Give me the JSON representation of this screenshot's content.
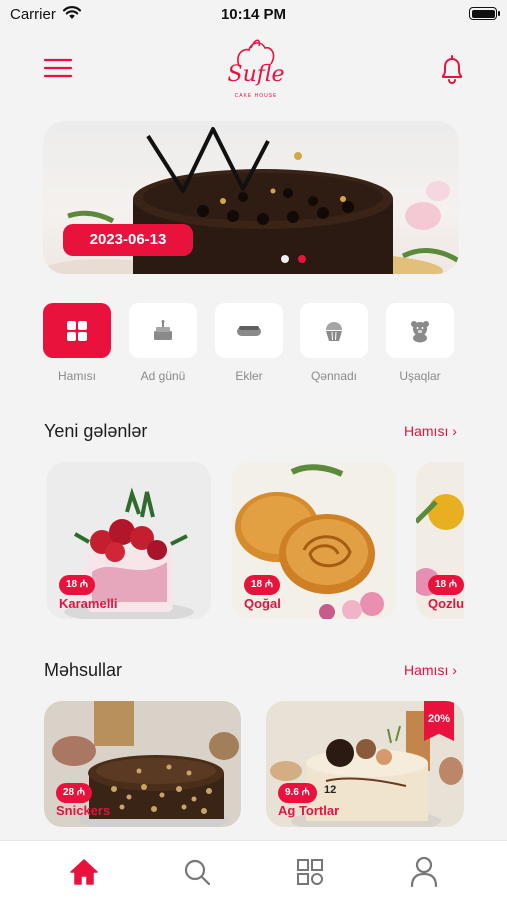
{
  "status_bar": {
    "carrier": "Carrier",
    "time": "10:14 PM"
  },
  "header": {
    "logo_text": "Sufle",
    "logo_subtext": "CAKE HOUSE"
  },
  "colors": {
    "accent": "#e8123c",
    "background": "#f3f3f3",
    "card": "#ffffff",
    "muted": "#8a8a8a"
  },
  "banner": {
    "date": "2023-06-13",
    "slide_count": 2,
    "active_slide": 2
  },
  "categories": [
    {
      "label": "Hamısı",
      "icon": "grid-icon",
      "active": true
    },
    {
      "label": "Ad günü",
      "icon": "birthday-cake-icon",
      "active": false
    },
    {
      "label": "Ekler",
      "icon": "eclair-icon",
      "active": false
    },
    {
      "label": "Qənnadı",
      "icon": "cupcake-icon",
      "active": false
    },
    {
      "label": "Uşaqlar",
      "icon": "teddy-bear-icon",
      "active": false
    }
  ],
  "new_arrivals": {
    "title": "Yeni gələnlər",
    "see_all": "Hamısı",
    "items": [
      {
        "name": "Karamelli",
        "price": "18 ₼"
      },
      {
        "name": "Qoğal",
        "price": "18 ₼"
      },
      {
        "name": "Qozlu",
        "price": "18 ₼"
      }
    ]
  },
  "products": {
    "title": "Məhsullar",
    "see_all": "Hamısı",
    "items": [
      {
        "name": "Snickers",
        "price": "28 ₼"
      },
      {
        "name": "Ag Tortlar",
        "price": "9.6 ₼",
        "discount": "20%",
        "extra": "12"
      }
    ]
  },
  "tab_bar": {
    "active": "home",
    "items": [
      {
        "icon": "home-icon"
      },
      {
        "icon": "search-icon"
      },
      {
        "icon": "categories-icon"
      },
      {
        "icon": "profile-icon"
      }
    ]
  }
}
